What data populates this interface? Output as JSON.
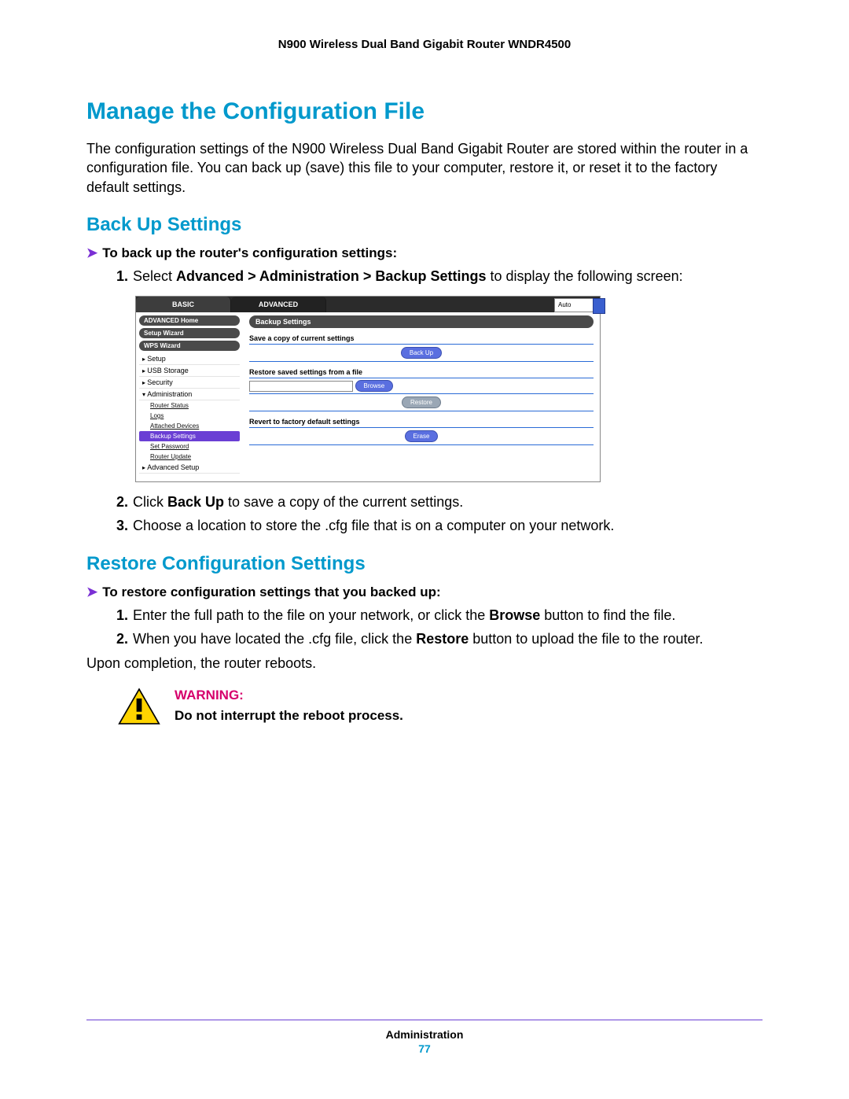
{
  "doc_header": "N900 Wireless Dual Band Gigabit Router WNDR4500",
  "h1": "Manage the Configuration File",
  "intro": "The configuration settings of the N900 Wireless Dual Band Gigabit Router are stored within the router in a configuration file. You can back up (save) this file to your computer, restore it, or reset it to the factory default settings.",
  "h2_backup": "Back Up Settings",
  "proc_backup_head": "To back up the router's configuration settings:",
  "backup_step1_pre": "Select ",
  "backup_step1_bold": "Advanced > Administration > Backup Settings",
  "backup_step1_post": " to display the following screen:",
  "backup_step2_pre": "Click ",
  "backup_step2_bold": "Back Up",
  "backup_step2_post": " to save a copy of the current settings.",
  "backup_step3": "Choose a location to store the .cfg file that is on a computer on your network.",
  "h2_restore": "Restore Configuration Settings",
  "proc_restore_head": "To restore configuration settings that you backed up:",
  "restore_step1_pre": "Enter the full path to the file on your network, or click the ",
  "restore_step1_bold": "Browse",
  "restore_step1_post": " button to find the file.",
  "restore_step2_pre": "When you have located the .cfg file, click the ",
  "restore_step2_bold": "Restore",
  "restore_step2_post": " button to upload the file to the router.",
  "restore_final": "Upon completion, the router reboots.",
  "warn_head": "WARNING:",
  "warn_body": "Do not interrupt the reboot process.",
  "footer_section": "Administration",
  "footer_page": "77",
  "ui": {
    "tab_basic": "BASIC",
    "tab_advanced": "ADVANCED",
    "auto": "Auto",
    "side_home": "ADVANCED Home",
    "side_setup_wiz": "Setup Wizard",
    "side_wps": "WPS Wizard",
    "side_setup": "Setup",
    "side_usb": "USB Storage",
    "side_security": "Security",
    "side_admin": "Administration",
    "sub_router_status": "Router Status",
    "sub_logs": "Logs",
    "sub_attached": "Attached Devices",
    "sub_backup": "Backup Settings",
    "sub_setpw": "Set Password",
    "sub_update": "Router Update",
    "side_advsetup": "Advanced Setup",
    "panel_title": "Backup Settings",
    "sec_save": "Save a copy of current settings",
    "btn_backup": "Back Up",
    "sec_restore": "Restore saved settings from a file",
    "btn_browse": "Browse",
    "btn_restore": "Restore",
    "sec_revert": "Revert to factory default settings",
    "btn_erase": "Erase"
  }
}
